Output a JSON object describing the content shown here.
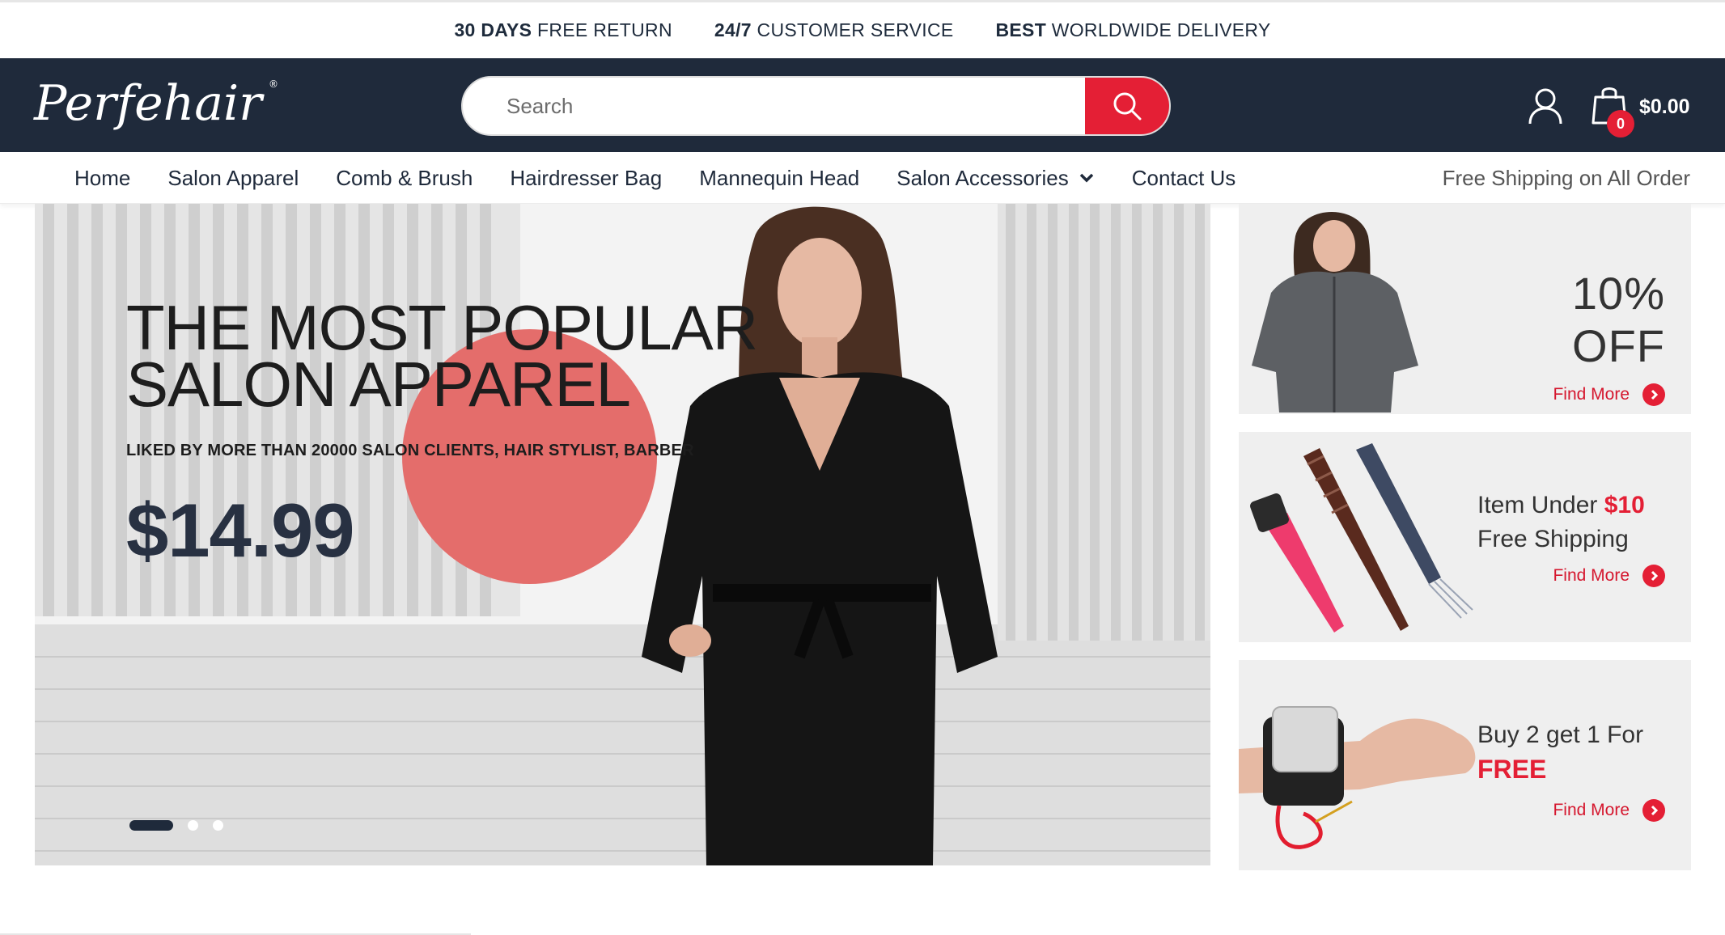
{
  "topbar": {
    "promos": [
      {
        "bold": "30 DAYS",
        "text": " FREE RETURN"
      },
      {
        "bold": "24/7",
        "text": " CUSTOMER SERVICE"
      },
      {
        "bold": "BEST",
        "text": " WORLDWIDE DELIVERY"
      }
    ]
  },
  "header": {
    "logo_text": "Perfehair",
    "search_placeholder": "Search",
    "cart_count": "0",
    "cart_total": "$0.00"
  },
  "nav": {
    "items": [
      "Home",
      "Salon Apparel",
      "Comb & Brush",
      "Hairdresser Bag",
      "Mannequin Head",
      "Salon Accessories",
      "Contact Us"
    ],
    "right_text": "Free Shipping on All Order"
  },
  "hero": {
    "title_line1": "THE MOST POPULAR",
    "title_line2": "SALON APPAREL",
    "subtitle": "LIKED BY MORE THAN 20000 SALON CLIENTS, HAIR STYLIST, BARBER",
    "price": "$14.99",
    "slides": 3,
    "active_slide": 1
  },
  "banners": [
    {
      "line1": "10% OFF",
      "cta": "Find More"
    },
    {
      "line1": "Item Under ",
      "highlight": "$10",
      "line2": "Free Shipping",
      "cta": "Find More"
    },
    {
      "line1": "Buy 2 get 1 For",
      "highlight": "FREE",
      "cta": "Find More"
    }
  ],
  "colors": {
    "header_bg": "#1f2a3b",
    "accent": "#e41f35",
    "circle": "#e46d6b"
  }
}
